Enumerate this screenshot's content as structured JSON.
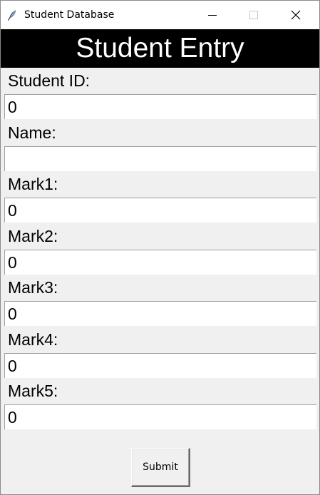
{
  "window": {
    "title": "Student Database",
    "icon": "feather-icon"
  },
  "header": {
    "title": "Student Entry"
  },
  "form": {
    "fields": [
      {
        "label": "Student ID:",
        "value": "0"
      },
      {
        "label": "Name:",
        "value": ""
      },
      {
        "label": "Mark1:",
        "value": "0"
      },
      {
        "label": "Mark2:",
        "value": "0"
      },
      {
        "label": "Mark3:",
        "value": "0"
      },
      {
        "label": "Mark4:",
        "value": "0"
      },
      {
        "label": "Mark5:",
        "value": "0"
      }
    ],
    "submit_label": "Submit"
  },
  "colors": {
    "header_bg": "#000000",
    "header_fg": "#ffffff",
    "window_bg": "#f0f0f0",
    "entry_bg": "#ffffff"
  }
}
